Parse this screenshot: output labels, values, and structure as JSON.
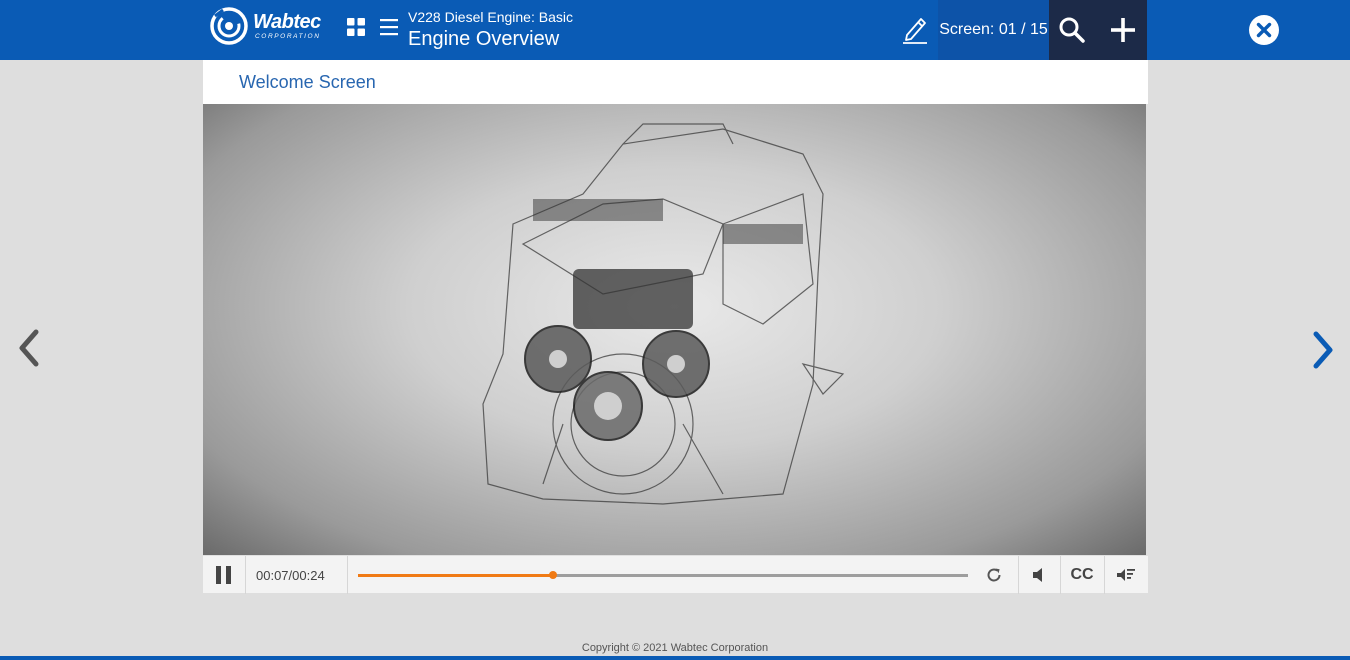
{
  "brand": {
    "name": "Wabtec",
    "sub": "CORPORATION"
  },
  "header": {
    "course_title": "V228 Diesel Engine: Basic",
    "module_title": "Engine Overview",
    "screen_counter": "Screen: 01 / 15"
  },
  "screen": {
    "title": "Welcome Screen"
  },
  "player": {
    "current_time": "00:07",
    "duration": "00:24",
    "time_separator": "/",
    "progress": 0.32,
    "cc_label": "CC"
  },
  "footer": {
    "copyright": "Copyright © 2021 Wabtec Corporation"
  },
  "icons": {
    "grid": "grid-icon",
    "menu": "menu-icon",
    "pencil": "pencil-icon",
    "search": "search-icon",
    "plus": "plus-icon",
    "close": "close-icon",
    "pause": "pause-icon",
    "replay": "replay-icon",
    "volume": "volume-icon",
    "audio_description": "audio-description-icon",
    "prev": "chevron-left-icon",
    "next": "chevron-right-icon"
  },
  "colors": {
    "header_bg": "#0a5bb5",
    "accent": "#f07a14",
    "screen_title": "#2866b0",
    "dark_block": "#1c2a48",
    "next_arrow": "#0a5bb5",
    "prev_arrow": "#555555"
  }
}
